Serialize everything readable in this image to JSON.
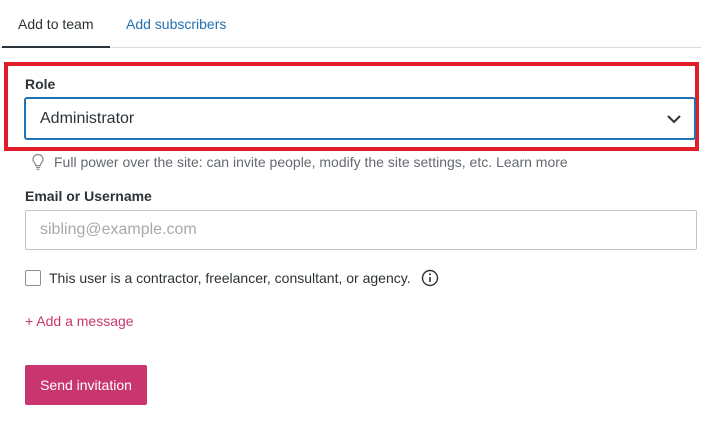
{
  "tabs": [
    {
      "label": "Add to team",
      "active": true
    },
    {
      "label": "Add subscribers",
      "active": false
    }
  ],
  "role": {
    "label": "Role",
    "selected": "Administrator",
    "hint": "Full power over the site: can invite people, modify the site settings, etc.",
    "learn_more": "Learn more"
  },
  "email": {
    "label": "Email or Username",
    "value": "",
    "placeholder": "sibling@example.com"
  },
  "contractor": {
    "label": "This user is a contractor, freelancer, consultant, or agency.",
    "checked": false
  },
  "add_message": "+ Add a message",
  "send_button": "Send invitation",
  "colors": {
    "accent": "#c9356e",
    "link": "#2271b1",
    "highlight": "#e11d2a"
  }
}
